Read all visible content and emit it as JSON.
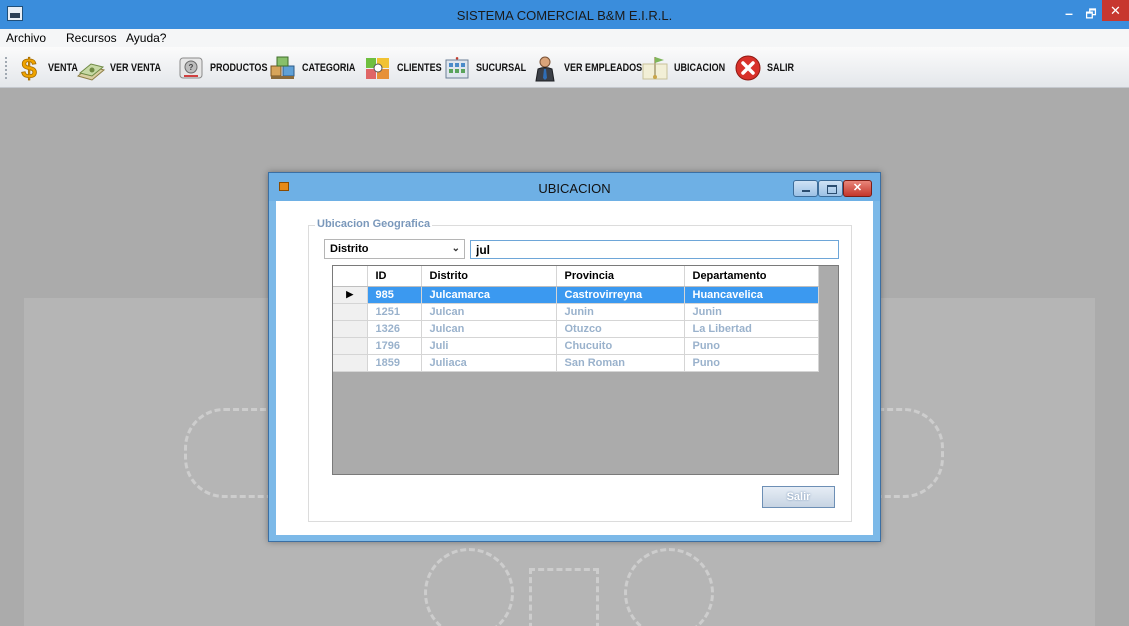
{
  "window": {
    "title": "SISTEMA COMERCIAL B&M E.I.R.L.",
    "min_glyph": "–",
    "max_glyph": "🗗",
    "close_glyph": "✕"
  },
  "menu": {
    "items": [
      "Archivo",
      "Recursos",
      "Ayuda?"
    ]
  },
  "toolbar": {
    "items": [
      {
        "label": "VENTA",
        "icon": "dollar-icon"
      },
      {
        "label": "VER VENTA",
        "icon": "money-icon"
      },
      {
        "label": "PRODUCTOS",
        "icon": "products-icon"
      },
      {
        "label": "CATEGORIA",
        "icon": "category-icon"
      },
      {
        "label": "CLIENTES",
        "icon": "clients-icon"
      },
      {
        "label": "SUCURSAL",
        "icon": "branch-icon"
      },
      {
        "label": "VER EMPLEADOS",
        "icon": "employee-icon"
      },
      {
        "label": "UBICACION",
        "icon": "location-icon"
      },
      {
        "label": "SALIR",
        "icon": "exit-icon"
      }
    ]
  },
  "dialog": {
    "title": "UBICACION",
    "group_label": "Ubicacion Geografica",
    "filter_field": "Distrito",
    "search_value": "jul",
    "columns": [
      "ID",
      "Distrito",
      "Provincia",
      "Departamento"
    ],
    "rows": [
      [
        "985",
        "Julcamarca",
        "Castrovirreyna",
        "Huancavelica"
      ],
      [
        "1251",
        "Julcan",
        "Junin",
        "Junin"
      ],
      [
        "1326",
        "Julcan",
        "Otuzco",
        "La Libertad"
      ],
      [
        "1796",
        "Juli",
        "Chucuito",
        "Puno"
      ],
      [
        "1859",
        "Juliaca",
        "San Roman",
        "Puno"
      ]
    ],
    "selected_row_marker": "▶",
    "salir_label": "Salir"
  },
  "colors": {
    "titlebar": "#3a8ddc",
    "workspace": "#ababab",
    "selection": "#3b99f0",
    "dialog_border": "#7cb9e8"
  }
}
